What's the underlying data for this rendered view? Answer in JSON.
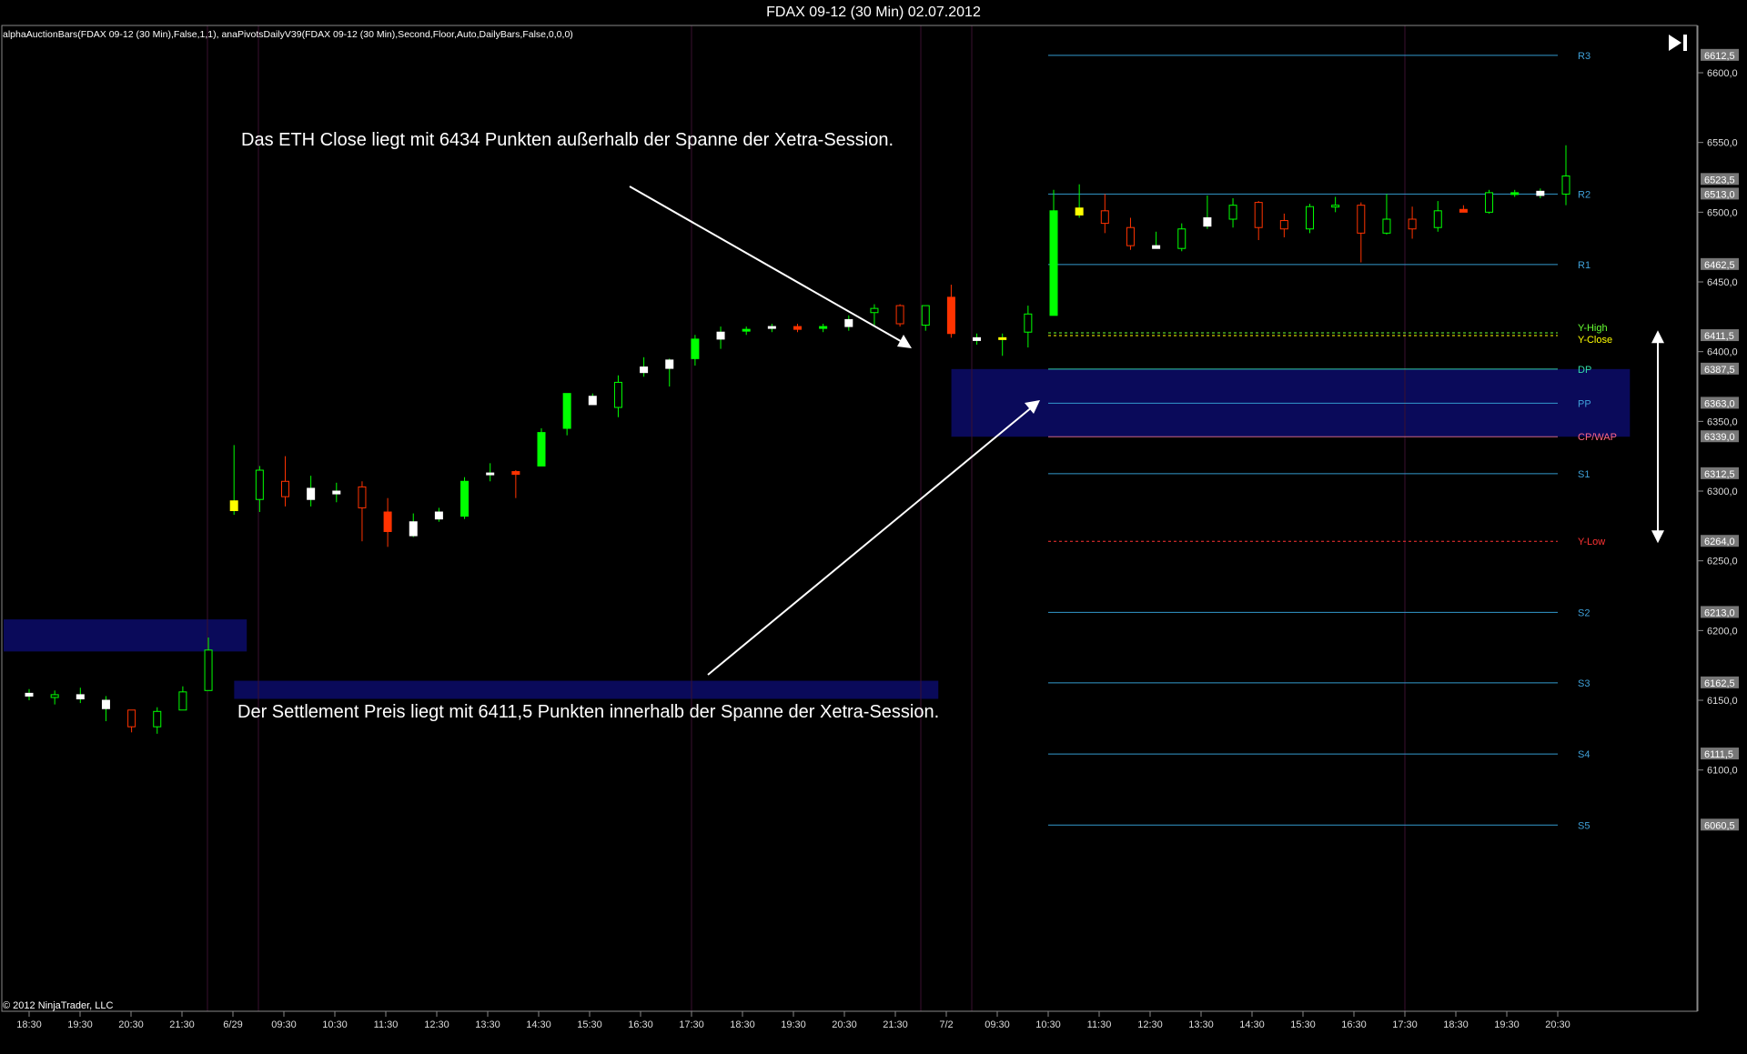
{
  "window": {
    "title": "FDAX 09-12 (30 Min)  02.07.2012"
  },
  "indicator_label": "alphaAuctionBars(FDAX 09-12 (30 Min),False,1,1), anaPivotsDailyV39(FDAX 09-12 (30 Min),Second,Floor,Auto,DailyBars,False,0,0,0)",
  "copyright": "© 2012 NinjaTrader, LLC",
  "annotations": {
    "top": "Das ETH Close liegt mit 6434 Punkten außerhalb der Spanne der Xetra-Session.",
    "bottom": "Der Settlement Preis liegt mit 6411,5 Punkten innerhalb der Spanne der Xetra-Session."
  },
  "toolbar": {
    "end_icon": "skip-to-end-icon"
  },
  "colors": {
    "background": "#000000",
    "bull_candle": "#00ff00",
    "bear_candle": "#ff3300",
    "pivot_line": "#3399cc",
    "y_low": "#ff3333",
    "y_high": "#66ff33",
    "y_close": "#ffff00",
    "zone": "#0a0a5a",
    "white_candle": "#ffffff",
    "yellow_candle": "#ffff00"
  },
  "chart_data": {
    "type": "candlestick",
    "title": "FDAX 09-12 (30 Min)  02.07.2012",
    "ylim": [
      6055,
      6620
    ],
    "y_ticks": [
      "6600,0",
      "6550,0",
      "6500,0",
      "6450,0",
      "6400,0",
      "6350,0",
      "6300,0",
      "6250,0",
      "6200,0",
      "6150,0",
      "6100,0"
    ],
    "x_ticks": [
      "18:30",
      "19:30",
      "20:30",
      "21:30",
      "6/29",
      "09:30",
      "10:30",
      "11:30",
      "12:30",
      "13:30",
      "14:30",
      "15:30",
      "16:30",
      "17:30",
      "18:30",
      "19:30",
      "20:30",
      "21:30",
      "7/2",
      "09:30",
      "10:30",
      "11:30",
      "12:30",
      "13:30",
      "14:30",
      "15:30",
      "16:30",
      "17:30",
      "18:30",
      "19:30",
      "20:30"
    ],
    "price_labels": [
      "6612,5",
      "6523,5",
      "6513,0",
      "6462,5",
      "6411,5",
      "6387,5",
      "6363,0",
      "6339,0",
      "6312,5",
      "6264,0",
      "6213,0",
      "6162,5",
      "6111,5",
      "6060,5"
    ],
    "pivot_levels": [
      {
        "name": "R3",
        "value": 6612.5
      },
      {
        "name": "R2",
        "value": 6513.0
      },
      {
        "name": "R1",
        "value": 6462.5
      },
      {
        "name": "Y-High",
        "value": 6413.5
      },
      {
        "name": "Y-Close",
        "value": 6411.5
      },
      {
        "name": "DP",
        "value": 6387.5
      },
      {
        "name": "PP",
        "value": 6363.0
      },
      {
        "name": "CP/WAP",
        "value": 6339.0
      },
      {
        "name": "S1",
        "value": 6312.5
      },
      {
        "name": "Y-Low",
        "value": 6264.0
      },
      {
        "name": "S2",
        "value": 6213.0
      },
      {
        "name": "S3",
        "value": 6162.5
      },
      {
        "name": "S4",
        "value": 6111.5
      },
      {
        "name": "S5",
        "value": 6060.5
      }
    ],
    "zones": [
      {
        "from_bar": 0,
        "to_bar": 8,
        "low": 6185,
        "high": 6208
      },
      {
        "from_bar": 9,
        "to_bar": 35,
        "low": 6151,
        "high": 6164
      },
      {
        "from_bar": 37,
        "to_bar": 62,
        "low": 6339,
        "high": 6387.5
      }
    ],
    "range_arrow": {
      "high": 6414,
      "low": 6264
    },
    "candles": [
      {
        "o": 6155,
        "h": 6158,
        "l": 6150,
        "c": 6153,
        "t": "white"
      },
      {
        "o": 6154,
        "h": 6157,
        "l": 6147,
        "c": 6152,
        "t": "bull"
      },
      {
        "o": 6154,
        "h": 6159,
        "l": 6148,
        "c": 6151,
        "t": "white"
      },
      {
        "o": 6150,
        "h": 6153,
        "l": 6135,
        "c": 6144,
        "t": "white"
      },
      {
        "o": 6143,
        "h": 6143,
        "l": 6127,
        "c": 6131,
        "t": "bear"
      },
      {
        "o": 6131,
        "h": 6145,
        "l": 6126,
        "c": 6142,
        "t": "bull"
      },
      {
        "o": 6143,
        "h": 6160,
        "l": 6143,
        "c": 6156,
        "t": "bull"
      },
      {
        "o": 6157,
        "h": 6195,
        "l": 6157,
        "c": 6186,
        "t": "bull"
      },
      {
        "o": 6293,
        "h": 6333,
        "l": 6283,
        "c": 6286,
        "t": "yellow"
      },
      {
        "o": 6294,
        "h": 6318,
        "l": 6285,
        "c": 6315,
        "t": "bull"
      },
      {
        "o": 6307,
        "h": 6325,
        "l": 6289,
        "c": 6296,
        "t": "bear"
      },
      {
        "o": 6302,
        "h": 6311,
        "l": 6289,
        "c": 6294,
        "t": "white"
      },
      {
        "o": 6298,
        "h": 6306,
        "l": 6292,
        "c": 6300,
        "t": "white"
      },
      {
        "o": 6303,
        "h": 6307,
        "l": 6264,
        "c": 6288,
        "t": "bear"
      },
      {
        "o": 6285,
        "h": 6295,
        "l": 6260,
        "c": 6271,
        "t": "redfill"
      },
      {
        "o": 6268,
        "h": 6284,
        "l": 6267,
        "c": 6278,
        "t": "white"
      },
      {
        "o": 6285,
        "h": 6288,
        "l": 6278,
        "c": 6280,
        "t": "white"
      },
      {
        "o": 6282,
        "h": 6310,
        "l": 6280,
        "c": 6307,
        "t": "greenfill"
      },
      {
        "o": 6313,
        "h": 6320,
        "l": 6307,
        "c": 6313,
        "t": "white"
      },
      {
        "o": 6314,
        "h": 6315,
        "l": 6295,
        "c": 6312,
        "t": "redfill"
      },
      {
        "o": 6318,
        "h": 6345,
        "l": 6318,
        "c": 6342,
        "t": "greenfill"
      },
      {
        "o": 6345,
        "h": 6370,
        "l": 6340,
        "c": 6370,
        "t": "greenfill"
      },
      {
        "o": 6368,
        "h": 6370,
        "l": 6365,
        "c": 6362,
        "t": "white"
      },
      {
        "o": 6360,
        "h": 6383,
        "l": 6353,
        "c": 6378,
        "t": "bull"
      },
      {
        "o": 6385,
        "h": 6396,
        "l": 6382,
        "c": 6389,
        "t": "white"
      },
      {
        "o": 6388,
        "h": 6395,
        "l": 6375,
        "c": 6394,
        "t": "white"
      },
      {
        "o": 6395,
        "h": 6412,
        "l": 6390,
        "c": 6409,
        "t": "greenfill"
      },
      {
        "o": 6409,
        "h": 6418,
        "l": 6402,
        "c": 6414,
        "t": "white"
      },
      {
        "o": 6415,
        "h": 6418,
        "l": 6412,
        "c": 6416,
        "t": "greenfill"
      },
      {
        "o": 6417,
        "h": 6420,
        "l": 6414,
        "c": 6418,
        "t": "white"
      },
      {
        "o": 6418,
        "h": 6420,
        "l": 6414,
        "c": 6416,
        "t": "redfill"
      },
      {
        "o": 6418,
        "h": 6420,
        "l": 6414,
        "c": 6417,
        "t": "greenfill"
      },
      {
        "o": 6418,
        "h": 6426,
        "l": 6415,
        "c": 6423,
        "t": "white"
      },
      {
        "o": 6428,
        "h": 6434,
        "l": 6419,
        "c": 6431,
        "t": "bull"
      },
      {
        "o": 6433,
        "h": 6434,
        "l": 6418,
        "c": 6420,
        "t": "bear"
      },
      {
        "o": 6419,
        "h": 6433,
        "l": 6415,
        "c": 6433,
        "t": "bull"
      },
      {
        "o": 6439,
        "h": 6448,
        "l": 6410,
        "c": 6413,
        "t": "redfill"
      },
      {
        "o": 6410,
        "h": 6413,
        "l": 6405,
        "c": 6408,
        "t": "white"
      },
      {
        "o": 6409,
        "h": 6413,
        "l": 6397,
        "c": 6410,
        "t": "yellow"
      },
      {
        "o": 6414,
        "h": 6433,
        "l": 6403,
        "c": 6427,
        "t": "bull"
      },
      {
        "o": 6426,
        "h": 6516,
        "l": 6426,
        "c": 6501,
        "t": "greenfill"
      },
      {
        "o": 6503,
        "h": 6520,
        "l": 6496,
        "c": 6498,
        "t": "yellow"
      },
      {
        "o": 6501,
        "h": 6513,
        "l": 6485,
        "c": 6492,
        "t": "bear"
      },
      {
        "o": 6489,
        "h": 6496,
        "l": 6473,
        "c": 6476,
        "t": "bear"
      },
      {
        "o": 6476,
        "h": 6486,
        "l": 6474,
        "c": 6474,
        "t": "white"
      },
      {
        "o": 6474,
        "h": 6492,
        "l": 6472,
        "c": 6488,
        "t": "bull"
      },
      {
        "o": 6490,
        "h": 6512,
        "l": 6488,
        "c": 6496,
        "t": "white"
      },
      {
        "o": 6495,
        "h": 6510,
        "l": 6489,
        "c": 6505,
        "t": "bull"
      },
      {
        "o": 6507,
        "h": 6508,
        "l": 6480,
        "c": 6489,
        "t": "bear"
      },
      {
        "o": 6494,
        "h": 6499,
        "l": 6482,
        "c": 6488,
        "t": "bear"
      },
      {
        "o": 6488,
        "h": 6506,
        "l": 6485,
        "c": 6504,
        "t": "bull"
      },
      {
        "o": 6505,
        "h": 6511,
        "l": 6500,
        "c": 6504,
        "t": "bull"
      },
      {
        "o": 6505,
        "h": 6507,
        "l": 6464,
        "c": 6485,
        "t": "bear"
      },
      {
        "o": 6485,
        "h": 6513,
        "l": 6484,
        "c": 6495,
        "t": "bull"
      },
      {
        "o": 6495,
        "h": 6504,
        "l": 6481,
        "c": 6488,
        "t": "bear"
      },
      {
        "o": 6489,
        "h": 6508,
        "l": 6486,
        "c": 6501,
        "t": "bull"
      },
      {
        "o": 6502,
        "h": 6505,
        "l": 6500,
        "c": 6500,
        "t": "redfill"
      },
      {
        "o": 6500,
        "h": 6516,
        "l": 6499,
        "c": 6514,
        "t": "bull"
      },
      {
        "o": 6514,
        "h": 6516,
        "l": 6511,
        "c": 6514,
        "t": "greenfill"
      },
      {
        "o": 6515,
        "h": 6517,
        "l": 6510,
        "c": 6512,
        "t": "white"
      },
      {
        "o": 6513,
        "h": 6548,
        "l": 6505,
        "c": 6526,
        "t": "bull"
      }
    ]
  }
}
